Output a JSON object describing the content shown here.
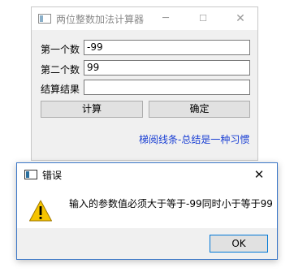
{
  "main_window": {
    "title": "两位整数加法计算器",
    "caption_buttons": {
      "minimize": "─",
      "maximize": "☐",
      "close": "✕"
    },
    "fields": [
      {
        "label": "第一个数",
        "value": "-99"
      },
      {
        "label": "第二个数",
        "value": "99"
      },
      {
        "label": "结算结果",
        "value": ""
      }
    ],
    "buttons": {
      "calculate": "计算",
      "confirm": "确定"
    },
    "link_text": "梯阅线条-总结是一种习惯"
  },
  "error_dialog": {
    "title": "错误",
    "close_glyph": "✕",
    "icon": "warning-icon",
    "message": "输入的参数值必须大于等于-99同时小于等于99",
    "ok_label": "OK"
  },
  "colors": {
    "link": "#1a3fd4",
    "dialog_border": "#3c78c8",
    "warning_fill": "#f5c400"
  }
}
